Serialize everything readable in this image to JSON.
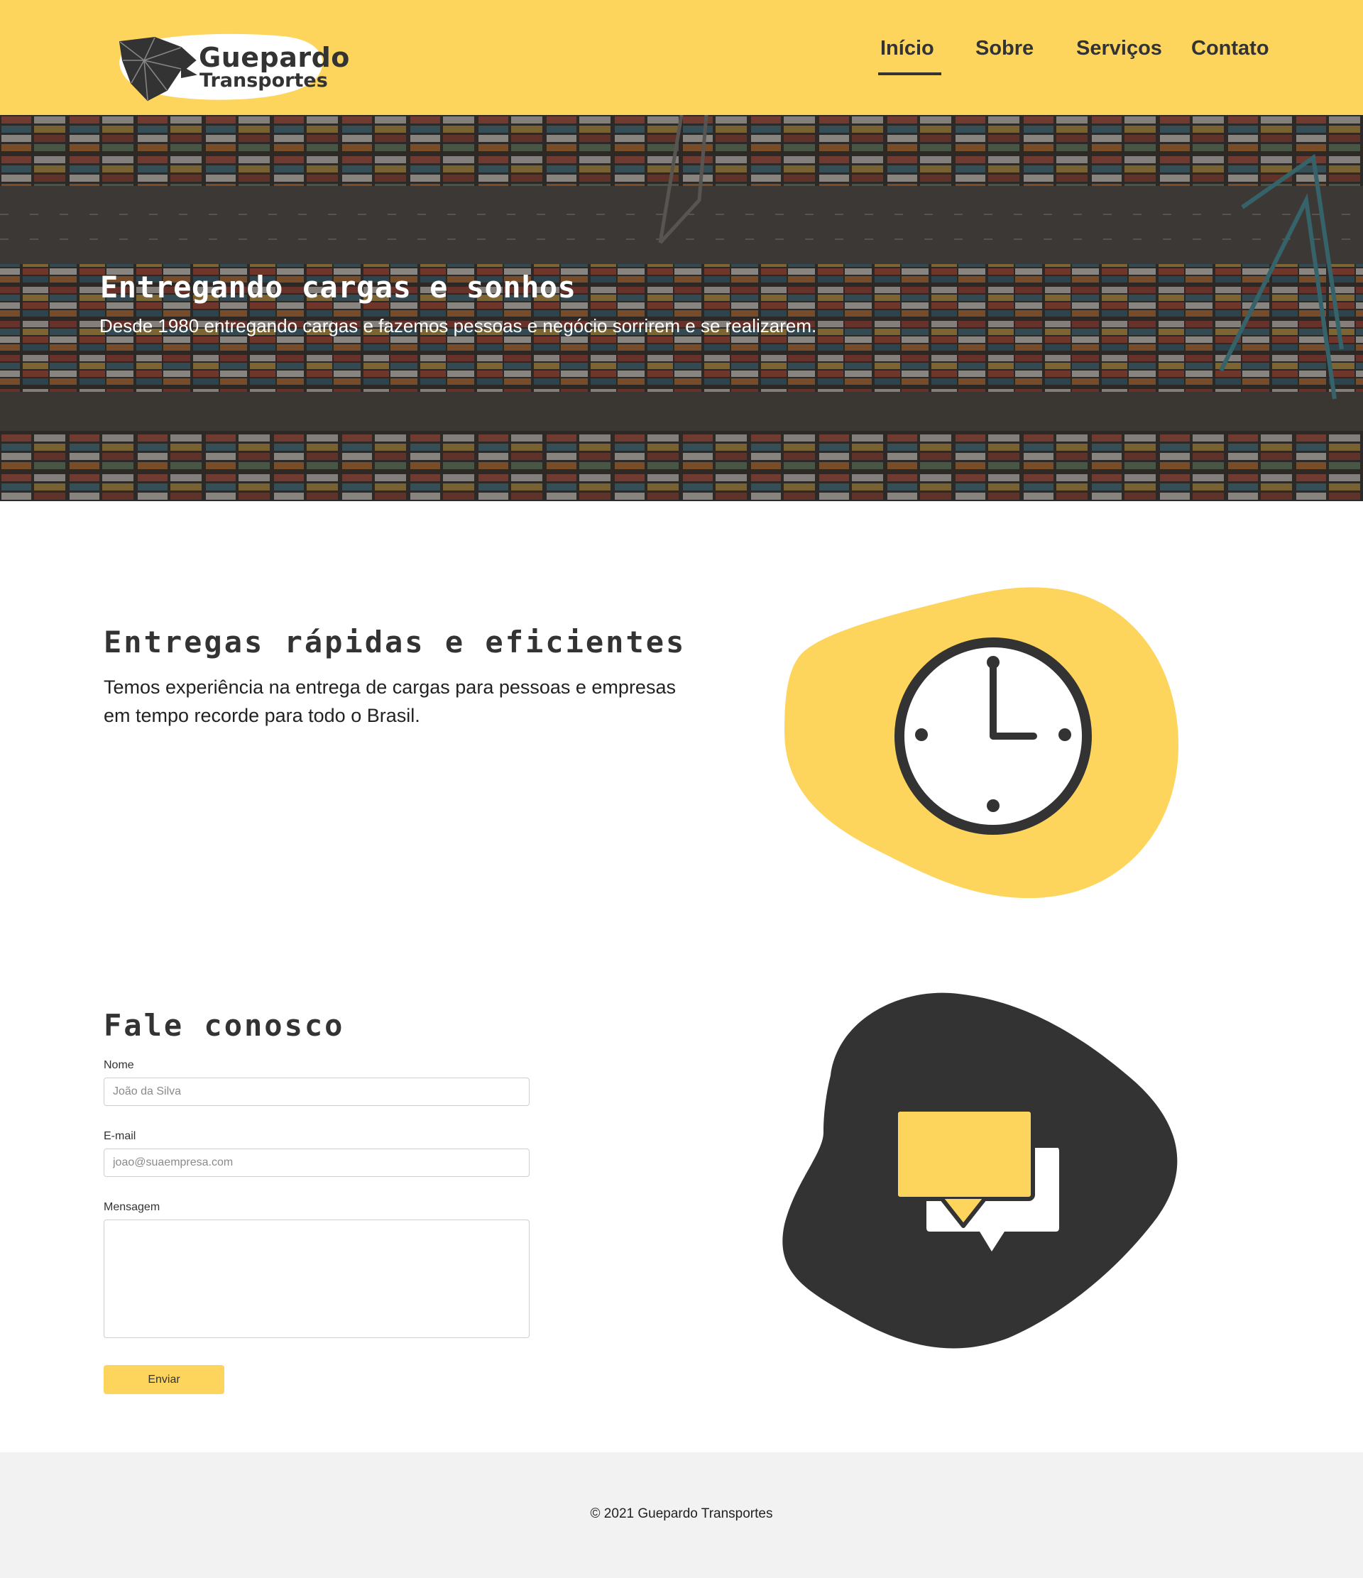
{
  "colors": {
    "brand_yellow": "#fdd55c",
    "dark": "#333333",
    "footer_bg": "#f2f2f2",
    "white": "#ffffff"
  },
  "header": {
    "logo": {
      "line1": "Guepardo",
      "line2": "Transportes",
      "icon": "cheetah-head-icon"
    },
    "nav": [
      {
        "label": "Início",
        "active": true
      },
      {
        "label": "Sobre",
        "active": false
      },
      {
        "label": "Serviços",
        "active": false
      },
      {
        "label": "Contato",
        "active": false
      }
    ]
  },
  "hero": {
    "title": "Entregando cargas e sonhos",
    "subtitle": "Desde 1980 entregando cargas e fazemos pessoas e negócio sorrirem e se realizarem.",
    "background": "aerial-container-port-image"
  },
  "features": {
    "title": "Entregas rápidas e eficientes",
    "text": "Temos experiência na entrega de cargas para pessoas e empresas em tempo recorde para todo o Brasil.",
    "icon": "clock-icon"
  },
  "contact": {
    "title": "Fale conosco",
    "name_label": "Nome",
    "name_placeholder": "João da Silva",
    "name_value": "",
    "email_label": "E-mail",
    "email_placeholder": "joao@suaempresa.com",
    "email_value": "",
    "message_label": "Mensagem",
    "message_value": "",
    "submit_label": "Enviar",
    "icon": "chat-bubbles-icon"
  },
  "footer": {
    "text": "© 2021 Guepardo Transportes"
  }
}
